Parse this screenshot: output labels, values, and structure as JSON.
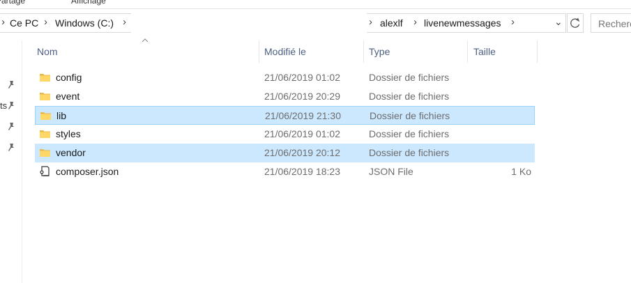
{
  "ribbon": {
    "tab_left": "Partage",
    "tab_right": "Affichage"
  },
  "address": {
    "crumbs_left": [
      "Ce PC",
      "Windows (C:)"
    ],
    "crumbs_right": [
      "alexlf",
      "livenewmessages"
    ],
    "separator": "›",
    "dropdown": "⌄"
  },
  "search": {
    "placeholder": "Rechercher"
  },
  "nav": {
    "partial_text": "ts"
  },
  "columns": {
    "name": "Nom",
    "date": "Modifié le",
    "type": "Type",
    "size": "Taille"
  },
  "files": [
    {
      "name": "config",
      "date": "21/06/2019 01:02",
      "type": "Dossier de fichiers",
      "size": "",
      "icon": "folder-icon",
      "state": "normal"
    },
    {
      "name": "event",
      "date": "21/06/2019 20:29",
      "type": "Dossier de fichiers",
      "size": "",
      "icon": "folder-icon",
      "state": "normal"
    },
    {
      "name": "lib",
      "date": "21/06/2019 21:30",
      "type": "Dossier de fichiers",
      "size": "",
      "icon": "folder-icon",
      "state": "selected-focused"
    },
    {
      "name": "styles",
      "date": "21/06/2019 01:02",
      "type": "Dossier de fichiers",
      "size": "",
      "icon": "folder-icon",
      "state": "normal"
    },
    {
      "name": "vendor",
      "date": "21/06/2019 20:12",
      "type": "Dossier de fichiers",
      "size": "",
      "icon": "folder-icon",
      "state": "selected"
    },
    {
      "name": "composer.json",
      "date": "21/06/2019 18:23",
      "type": "JSON File",
      "size": "1 Ko",
      "icon": "json-file-icon",
      "state": "normal"
    }
  ],
  "colors": {
    "selection": "#cce8ff",
    "selection_border": "#99d1ff",
    "folder": "#ffd767",
    "header_text": "#4d6082"
  }
}
